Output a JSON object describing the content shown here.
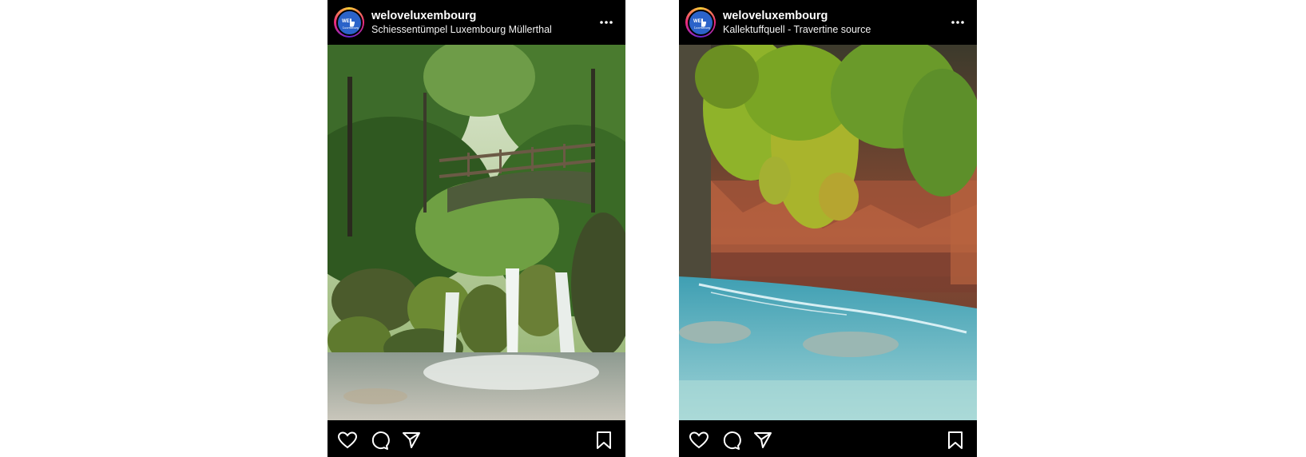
{
  "posts": [
    {
      "username": "weloveluxembourg",
      "location": "Schiessentümpel Luxembourg Müllerthal",
      "photo": "waterfall-bridge-forest"
    },
    {
      "username": "weloveluxembourg",
      "location": "Kallektuffquell - Travertine source",
      "photo": "mossy-travertine-turquoise-pool"
    }
  ],
  "avatar": {
    "text_top": "WE",
    "text_bottom": "Luxembourg"
  },
  "icons": [
    "more-horizontal-icon",
    "heart-icon",
    "comment-icon",
    "share-icon",
    "bookmark-icon"
  ],
  "colors": {
    "background": "#000000",
    "text": "#ffffff",
    "avatar": "#2b63c9"
  }
}
